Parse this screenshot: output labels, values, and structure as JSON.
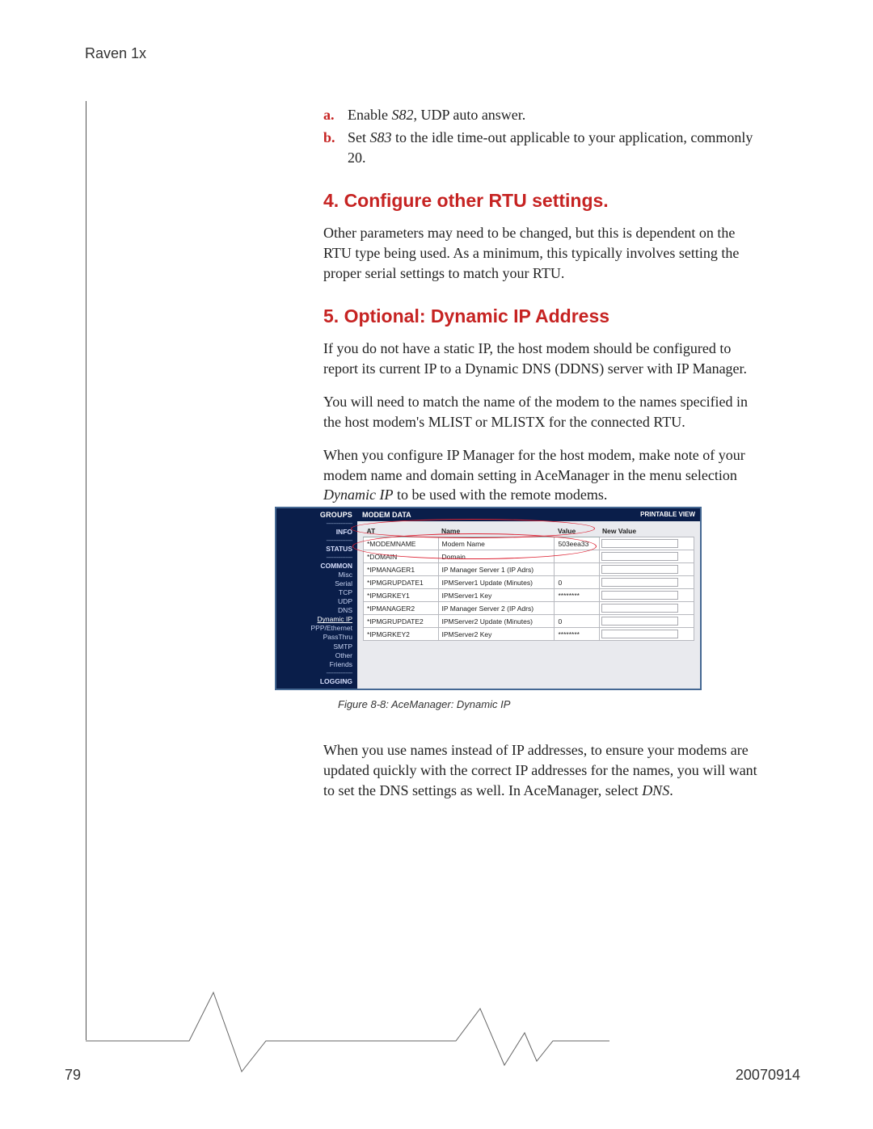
{
  "doc_header": "Raven 1x",
  "list_items": {
    "a": {
      "marker": "a.",
      "pre": "Enable ",
      "em": "S82",
      "post": ", UDP auto answer."
    },
    "b": {
      "marker": "b.",
      "pre": "Set ",
      "em": "S83",
      "post": " to the idle time-out applicable to your application, commonly 20."
    }
  },
  "sect4": {
    "title": "4. Configure other RTU settings.",
    "p1": "Other parameters may need to be changed, but this is dependent on the RTU type being used. As a minimum, this typically involves setting the proper serial settings to match your RTU."
  },
  "sect5": {
    "title": "5. Optional: Dynamic IP Address",
    "p1": "If you do not have a static IP, the host modem should be configured to report its current IP to a Dynamic DNS (DDNS) server with IP Manager.",
    "p2": "You will need to match the name of the modem to the names specified in the host modem's MLIST or MLISTX for the connected RTU.",
    "p3_pre": "When you configure IP Manager for the host modem, make note of your modem name and domain setting in AceManager in the menu selection ",
    "p3_em": "Dynamic IP",
    "p3_post": " to be used with the remote modems."
  },
  "figure": {
    "caption": "Figure 8-8: AceManager: Dynamic IP",
    "side_header": "GROUPS",
    "main_header": "MODEM DATA",
    "printable": "PRINTABLE VIEW",
    "side_items": [
      {
        "label": "INFO",
        "cls": "item"
      },
      {
        "label": "STATUS",
        "cls": "item"
      },
      {
        "label": "COMMON",
        "cls": "item"
      },
      {
        "label": "Misc",
        "cls": "item sub"
      },
      {
        "label": "Serial",
        "cls": "item sub"
      },
      {
        "label": "TCP",
        "cls": "item sub"
      },
      {
        "label": "UDP",
        "cls": "item sub"
      },
      {
        "label": "DNS",
        "cls": "item sub"
      },
      {
        "label": "Dynamic IP",
        "cls": "item sub sel"
      },
      {
        "label": "PPP/Ethernet",
        "cls": "item sub"
      },
      {
        "label": "PassThru",
        "cls": "item sub"
      },
      {
        "label": "SMTP",
        "cls": "item sub"
      },
      {
        "label": "Other",
        "cls": "item sub"
      },
      {
        "label": "Friends",
        "cls": "item sub"
      },
      {
        "label": "LOGGING",
        "cls": "item"
      }
    ],
    "cols": {
      "c1": "AT",
      "c2": "Name",
      "c3": "Value",
      "c4": "New Value"
    },
    "rows": [
      {
        "at": "*MODEMNAME",
        "name": "Modem Name",
        "value": "503eea33"
      },
      {
        "at": "*DOMAIN",
        "name": "Domain",
        "value": ""
      },
      {
        "at": "*IPMANAGER1",
        "name": "IP Manager Server 1 (IP Adrs)",
        "value": ""
      },
      {
        "at": "*IPMGRUPDATE1",
        "name": "IPMServer1 Update (Minutes)",
        "value": "0"
      },
      {
        "at": "*IPMGRKEY1",
        "name": "IPMServer1 Key",
        "value": "********"
      },
      {
        "at": "*IPMANAGER2",
        "name": "IP Manager Server 2 (IP Adrs)",
        "value": ""
      },
      {
        "at": "*IPMGRUPDATE2",
        "name": "IPMServer2 Update (Minutes)",
        "value": "0"
      },
      {
        "at": "*IPMGRKEY2",
        "name": "IPMServer2 Key",
        "value": "********"
      }
    ]
  },
  "after_fig": {
    "p_pre": "When you use names instead of IP addresses, to ensure your modems are updated quickly with the correct IP addresses for the names, you will want to set the DNS settings as well. In AceManager, select ",
    "p_em": "DNS",
    "p_post": "."
  },
  "footer": {
    "page": "79",
    "date": "20070914"
  }
}
